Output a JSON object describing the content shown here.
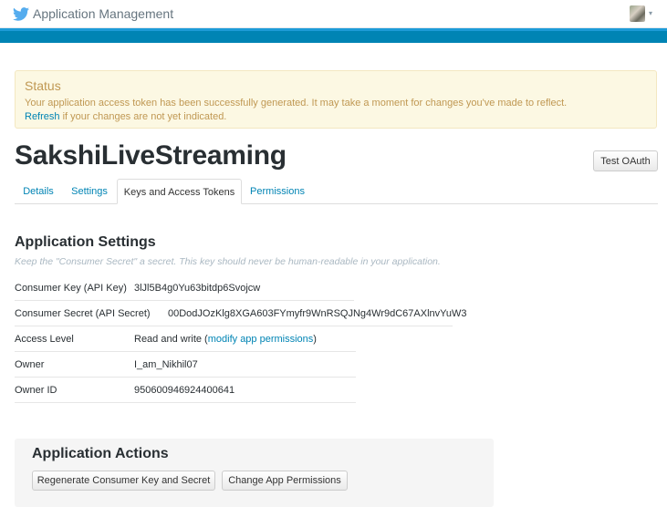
{
  "header": {
    "title": "Application Management",
    "bird_color": "#55acee",
    "avatar_caret": "▾"
  },
  "status": {
    "title": "Status",
    "message": "Your application access token has been successfully generated. It may take a moment for changes you've made to reflect.",
    "refresh_link": "Refresh",
    "refresh_suffix": " if your changes are not yet indicated."
  },
  "app": {
    "name": "SakshiLiveStreaming",
    "test_oauth_label": "Test OAuth"
  },
  "tabs": [
    {
      "label": "Details",
      "active": false
    },
    {
      "label": "Settings",
      "active": false
    },
    {
      "label": "Keys and Access Tokens",
      "active": true
    },
    {
      "label": "Permissions",
      "active": false
    }
  ],
  "settings": {
    "title": "Application Settings",
    "note": "Keep the \"Consumer Secret\" a secret. This key should never be human-readable in your application.",
    "rows": [
      {
        "label": "Consumer Key (API Key)",
        "value": "3lJl5B4g0Yu63bitdp6Svojcw"
      },
      {
        "label": "Consumer Secret (API Secret)",
        "value": "00DodJOzKlg8XGA603FYmyfr9WnRSQJNg4Wr9dC67AXlnvYuW3"
      },
      {
        "label": "Access Level",
        "value": "Read and write",
        "link": "modify app permissions"
      },
      {
        "label": "Owner",
        "value": "I_am_Nikhil07"
      },
      {
        "label": "Owner ID",
        "value": "950600946924400641"
      }
    ]
  },
  "actions": {
    "title": "Application Actions",
    "regenerate_label": "Regenerate Consumer Key and Secret",
    "change_permissions_label": "Change App Permissions"
  }
}
